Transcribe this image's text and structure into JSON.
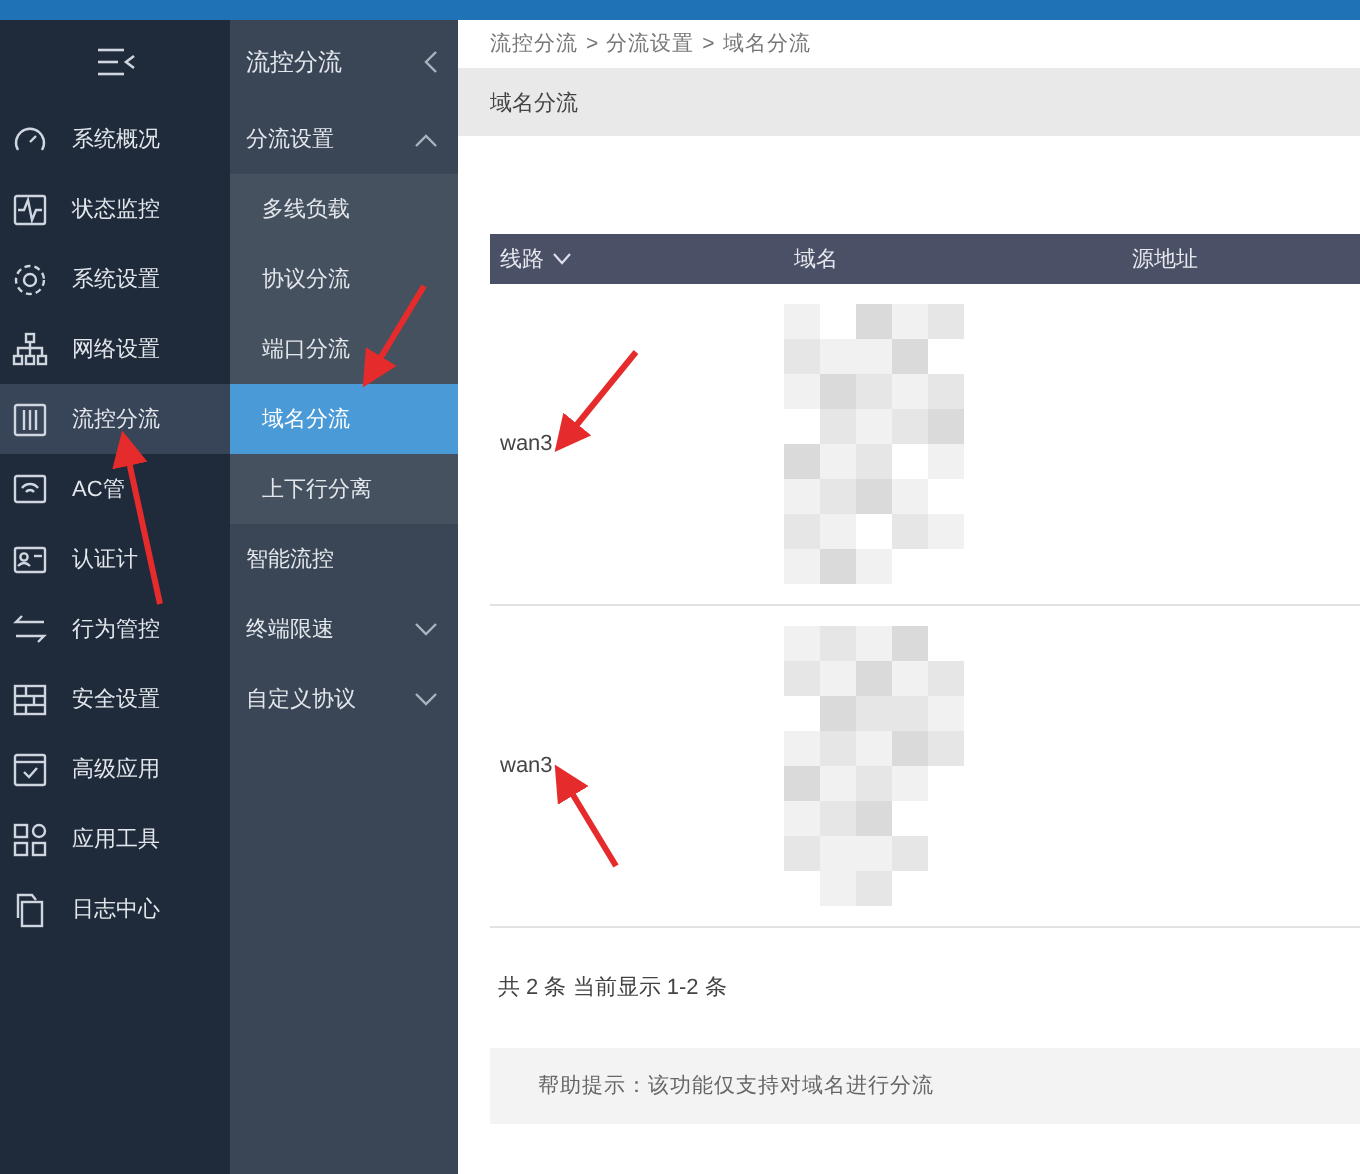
{
  "nav": {
    "items": [
      {
        "label": "系统概况",
        "selected": false
      },
      {
        "label": "状态监控",
        "selected": false
      },
      {
        "label": "系统设置",
        "selected": false
      },
      {
        "label": "网络设置",
        "selected": false
      },
      {
        "label": "流控分流",
        "selected": true
      },
      {
        "label": "AC管",
        "selected": false
      },
      {
        "label": "认证计",
        "selected": false
      },
      {
        "label": "行为管控",
        "selected": false
      },
      {
        "label": "安全设置",
        "selected": false
      },
      {
        "label": "高级应用",
        "selected": false
      },
      {
        "label": "应用工具",
        "selected": false
      },
      {
        "label": "日志中心",
        "selected": false
      }
    ]
  },
  "subnav": {
    "title": "流控分流",
    "items": [
      {
        "label": "分流设置",
        "kind": "group",
        "expanded": true,
        "children": [
          {
            "label": "多线负载",
            "selected": false
          },
          {
            "label": "协议分流",
            "selected": false
          },
          {
            "label": "端口分流",
            "selected": false
          },
          {
            "label": "域名分流",
            "selected": true
          },
          {
            "label": "上下行分离",
            "selected": false
          }
        ]
      },
      {
        "label": "智能流控",
        "kind": "item",
        "selected": false
      },
      {
        "label": "终端限速",
        "kind": "group",
        "expanded": false
      },
      {
        "label": "自定义协议",
        "kind": "group",
        "expanded": false
      }
    ]
  },
  "breadcrumb": [
    {
      "label": "流控分流"
    },
    {
      "separator": ">",
      "label": "分流设置"
    },
    {
      "separator": ">",
      "label": "域名分流"
    }
  ],
  "page_title": "域名分流",
  "table": {
    "columns": [
      "线路",
      "域名",
      "源地址"
    ],
    "rows": [
      {
        "line": "wan3"
      },
      {
        "line": "wan3"
      }
    ]
  },
  "summary": "共 2 条 当前显示 1-2 条",
  "help": "帮助提示：该功能仅支持对域名进行分流"
}
